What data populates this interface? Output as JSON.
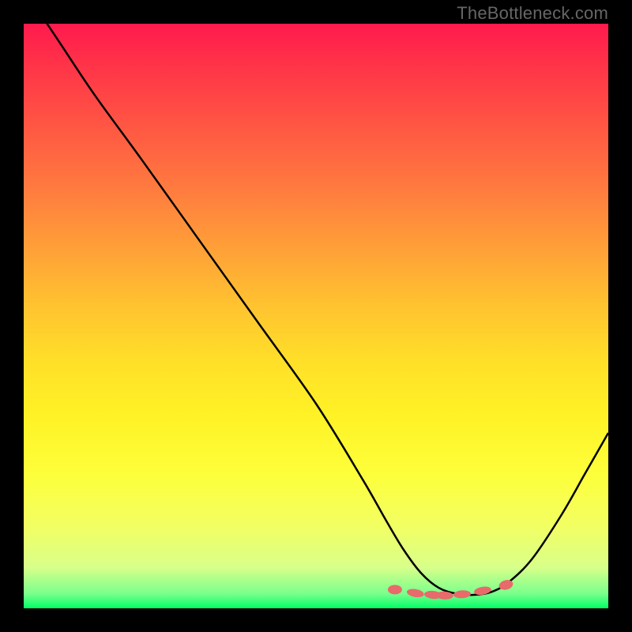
{
  "watermark": "TheBottleneck.com",
  "chart_data": {
    "type": "line",
    "title": "",
    "xlabel": "",
    "ylabel": "",
    "xlim": [
      0,
      1
    ],
    "ylim": [
      0,
      1
    ],
    "series": [
      {
        "name": "bottleneck-curve",
        "x": [
          0.0,
          0.06,
          0.12,
          0.2,
          0.3,
          0.4,
          0.5,
          0.58,
          0.62,
          0.65,
          0.68,
          0.71,
          0.74,
          0.77,
          0.8,
          0.83,
          0.87,
          0.92,
          0.96,
          1.0
        ],
        "y": [
          1.06,
          0.97,
          0.88,
          0.77,
          0.63,
          0.49,
          0.35,
          0.22,
          0.15,
          0.1,
          0.06,
          0.035,
          0.025,
          0.023,
          0.028,
          0.045,
          0.085,
          0.16,
          0.23,
          0.3
        ]
      }
    ],
    "markers": {
      "name": "optimum-dots",
      "style": "rounded-red",
      "x": [
        0.635,
        0.67,
        0.7,
        0.72,
        0.75,
        0.785,
        0.825
      ],
      "y": [
        0.032,
        0.026,
        0.023,
        0.022,
        0.024,
        0.03,
        0.04
      ]
    }
  }
}
